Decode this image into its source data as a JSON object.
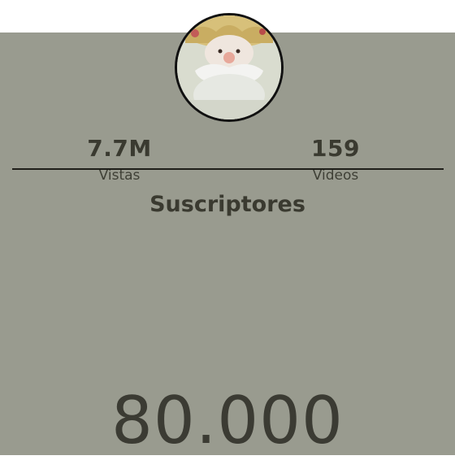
{
  "stats": {
    "views": {
      "value": "7.7M",
      "label": "Vistas"
    },
    "videos": {
      "value": "159",
      "label": "Videos"
    }
  },
  "subscribers": {
    "title": "Suscriptores",
    "count": "80.000"
  },
  "avatar": {
    "icon": "santa-claus-avatar-icon"
  },
  "colors": {
    "panel_background": "#999b8f",
    "text": "#3a3a30",
    "divider": "#1f1f1a",
    "avatar_border": "#111111"
  }
}
